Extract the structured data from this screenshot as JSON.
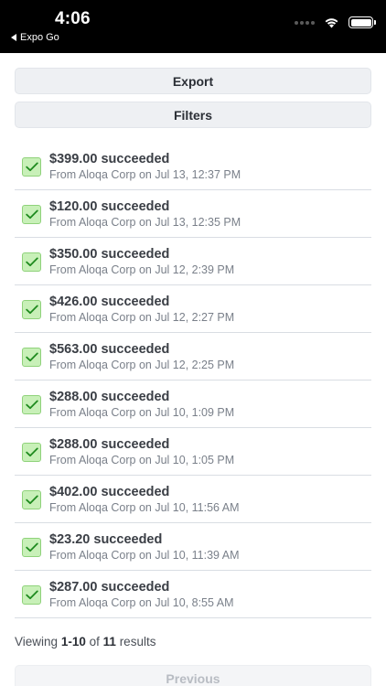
{
  "status_bar": {
    "time": "4:06",
    "back_app": "Expo Go"
  },
  "actions": {
    "export_label": "Export",
    "filters_label": "Filters"
  },
  "payments": [
    {
      "amount": "$399.00",
      "status": "succeeded",
      "details": "From Aloqa Corp on Jul 13, 12:37 PM"
    },
    {
      "amount": "$120.00",
      "status": "succeeded",
      "details": "From Aloqa Corp on Jul 13, 12:35 PM"
    },
    {
      "amount": "$350.00",
      "status": "succeeded",
      "details": "From Aloqa Corp on Jul 12, 2:39 PM"
    },
    {
      "amount": "$426.00",
      "status": "succeeded",
      "details": "From Aloqa Corp on Jul 12, 2:27 PM"
    },
    {
      "amount": "$563.00",
      "status": "succeeded",
      "details": "From Aloqa Corp on Jul 12, 2:25 PM"
    },
    {
      "amount": "$288.00",
      "status": "succeeded",
      "details": "From Aloqa Corp on Jul 10, 1:09 PM"
    },
    {
      "amount": "$288.00",
      "status": "succeeded",
      "details": "From Aloqa Corp on Jul 10, 1:05 PM"
    },
    {
      "amount": "$402.00",
      "status": "succeeded",
      "details": "From Aloqa Corp on Jul 10, 11:56 AM"
    },
    {
      "amount": "$23.20",
      "status": "succeeded",
      "details": "From Aloqa Corp on Jul 10, 11:39 AM"
    },
    {
      "amount": "$287.00",
      "status": "succeeded",
      "details": "From Aloqa Corp on Jul 10, 8:55 AM"
    }
  ],
  "pagination": {
    "prefix": "Viewing",
    "range": "1-10",
    "of": "of",
    "total": "11",
    "suffix": "results",
    "previous_label": "Previous"
  },
  "colors": {
    "status_bar_bg": "#000000",
    "button_bg": "#eef0f3",
    "check_bg": "#c8f0b8",
    "check_mark": "#1e8a1e"
  },
  "icons": {
    "status": [
      "wifi-icon",
      "battery-icon",
      "signal-dots-icon"
    ],
    "row": "checkmark-icon"
  }
}
